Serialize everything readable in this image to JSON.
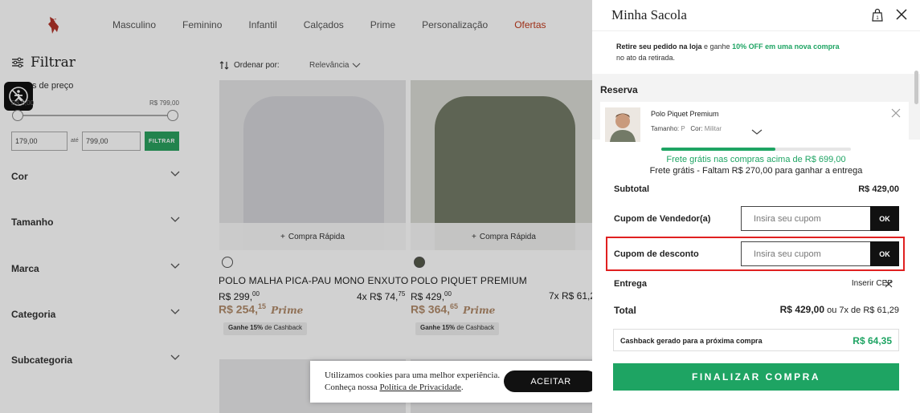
{
  "store": {
    "nav": [
      "Masculino",
      "Feminino",
      "Infantil",
      "Calçados",
      "Prime",
      "Personalização",
      "Ofertas"
    ],
    "filter_title": "Filtrar",
    "price_filter_label": "s de preço",
    "range_min": "R$ 0,00",
    "range_max": "R$ 799,00",
    "price_from": "179,00",
    "price_to_word": "até",
    "price_to": "799,00",
    "filter_button": "FILTRAR",
    "facets": [
      "Cor",
      "Tamanho",
      "Marca",
      "Categoria",
      "Subcategoria"
    ],
    "sort_label": "Ordenar por:",
    "sort_value": "Relevância",
    "quick_buy": "Compra Rápida",
    "products": [
      {
        "name": "POLO MALHA PICA-PAU MONO ENXUTO",
        "price_main": "R$ 299,",
        "price_cents": "00",
        "installments_main": "4x R$ 74,",
        "installments_cents": "75",
        "prime_main": "R$ 254,",
        "prime_cents": "15",
        "prime_tag": "Prime",
        "cashback_bold": "Ganhe 15%",
        "cashback_rest": " de Cashback",
        "swatch_color": "#ffffff"
      },
      {
        "name": "POLO PIQUET PREMIUM",
        "price_main": "R$ 429,",
        "price_cents": "00",
        "installments_main": "7x R$ 61,2",
        "installments_cents": "",
        "prime_main": "R$ 364,",
        "prime_cents": "65",
        "prime_tag": "Prime",
        "cashback_bold": "Ganhe 15%",
        "cashback_rest": " de Cashback",
        "swatch_color": "#55594a"
      }
    ]
  },
  "cookie": {
    "text_1": "Utilizamos cookies para uma melhor experiência.",
    "text_2": "Conheça nossa ",
    "link": "Política de Privacidade",
    "text_3": ".",
    "accept": "ACEITAR"
  },
  "bag": {
    "title": "Minha Sacola",
    "pickup_bold": "Retire seu pedido na loja",
    "pickup_mid": " e ganhe ",
    "pickup_green": "10% OFF em uma nova compra",
    "pickup_tail": "no ato da retirada.",
    "reserve_title": "Reserva",
    "item": {
      "name": "Polo Piquet Premium",
      "size_label": "Tamanho:",
      "size_value": "P",
      "color_label": "Cor:",
      "color_value": "Militar"
    },
    "shipping_progress": 0.6,
    "shipping_line1": "Frete grátis nas compras acima de R$ 699,00",
    "shipping_line2": "Frete grátis - Faltam R$ 270,00 para ganhar a entrega",
    "subtotal_label": "Subtotal",
    "subtotal_value": "R$ 429,00",
    "seller_coupon_label": "Cupom de Vendedor(a)",
    "coupon_placeholder": "Insira seu cupom",
    "ok": "OK",
    "discount_coupon_label": "Cupom de desconto",
    "delivery_label": "Entrega",
    "cep_label": "Inserir CEP",
    "total_label": "Total",
    "total_value": "R$ 429,00",
    "total_installments": " ou 7x de R$ 61,29",
    "cashback_label": "Cashback gerado para a próxima compra",
    "cashback_value": "R$ 64,35",
    "checkout": "FINALIZAR COMPRA",
    "accent": "#1ea463",
    "highlight_color": "#e02020"
  }
}
